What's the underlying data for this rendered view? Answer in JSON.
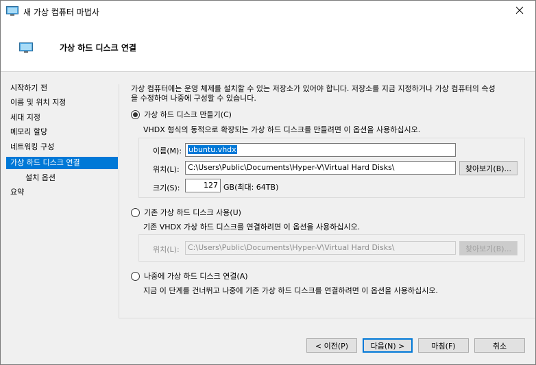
{
  "window": {
    "title": "새 가상 컴퓨터 마법사"
  },
  "header": {
    "title": "가상 하드 디스크 연결"
  },
  "nav": {
    "items": [
      {
        "label": "시작하기 전",
        "active": false,
        "sub": false
      },
      {
        "label": "이름 및 위치 지정",
        "active": false,
        "sub": false
      },
      {
        "label": "세대 지정",
        "active": false,
        "sub": false
      },
      {
        "label": "메모리 할당",
        "active": false,
        "sub": false
      },
      {
        "label": "네트워킹 구성",
        "active": false,
        "sub": false
      },
      {
        "label": "가상 하드 디스크 연결",
        "active": true,
        "sub": false
      },
      {
        "label": "설치 옵션",
        "active": false,
        "sub": true
      },
      {
        "label": "요약",
        "active": false,
        "sub": false
      }
    ]
  },
  "main": {
    "intro_line1": "가상 컴퓨터에는 운영 체제를 설치할 수 있는 저장소가 있어야 합니다. 저장소를 지금 지정하거나 가상 컴퓨터의 속성",
    "intro_line2": "을 수정하여 나중에 구성할 수 있습니다.",
    "option_create": {
      "label": "가상 하드 디스크 만들기(C)",
      "checked": true,
      "description": "VHDX 형식의 동적으로 확장되는 가상 하드 디스크를 만들려면 이 옵션을 사용하십시오.",
      "name_label": "이름(M):",
      "name_value": "ubuntu.vhdx",
      "location_label": "위치(L):",
      "location_value": "C:\\Users\\Public\\Documents\\Hyper-V\\Virtual Hard Disks\\",
      "browse_label": "찾아보기(B)...",
      "size_label": "크기(S):",
      "size_value": "127",
      "size_unit": "GB(최대: 64TB)"
    },
    "option_existing": {
      "label": "기존 가상 하드 디스크 사용(U)",
      "checked": false,
      "description": "기존 VHDX 가상 하드 디스크를 연결하려면 이 옵션을 사용하십시오.",
      "location_label": "위치(L):",
      "location_value": "C:\\Users\\Public\\Documents\\Hyper-V\\Virtual Hard Disks\\",
      "browse_label": "찾아보기(B)..."
    },
    "option_later": {
      "label": "나중에 가상 하드 디스크 연결(A)",
      "checked": false,
      "description": "지금 이 단계를 건너뛰고 나중에 기존 가상 하드 디스크를 연결하려면 이 옵션을 사용하십시오."
    }
  },
  "footer": {
    "prev_label": "< 이전(P)",
    "next_label": "다음(N) >",
    "finish_label": "마침(F)",
    "cancel_label": "취소"
  },
  "colors": {
    "accent": "#0078d7",
    "window_bg": "#f0f0f0",
    "header_bg": "#ffffff"
  }
}
